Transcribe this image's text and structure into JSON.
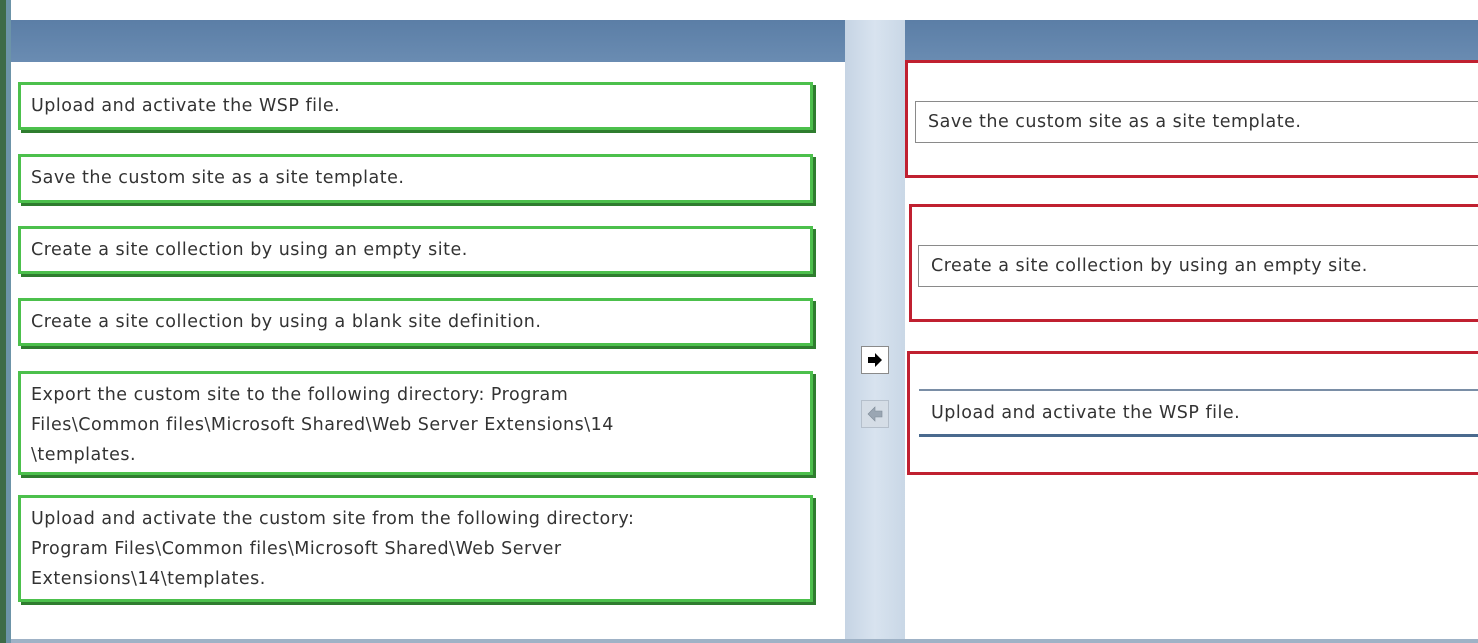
{
  "source_items": [
    {
      "text": "Upload and activate the WSP file."
    },
    {
      "text": "Save the custom site as a site template."
    },
    {
      "text": "Create a site collection by using an empty site."
    },
    {
      "text": "Create a site collection by using a blank site definition."
    },
    {
      "text_lines": [
        "Export the custom site to the following directory: Program",
        "Files\\Common files\\Microsoft Shared\\Web Server Extensions\\14",
        "\\templates."
      ]
    },
    {
      "text_lines": [
        "Upload and activate the custom site from the following directory:",
        "Program Files\\Common files\\Microsoft Shared\\Web Server",
        "Extensions\\14\\templates."
      ]
    }
  ],
  "answer_slots": [
    {
      "text": "Save the custom site as a site template."
    },
    {
      "text": "Create a site collection by using an empty site."
    },
    {
      "text": "Upload and activate the WSP file."
    }
  ],
  "buttons": {
    "move_right_icon": "arrow-right-icon",
    "move_left_icon": "arrow-left-icon"
  },
  "colors": {
    "source_border": "#4cc04c",
    "slot_border": "#c02030",
    "header": "#5b7ea6"
  }
}
